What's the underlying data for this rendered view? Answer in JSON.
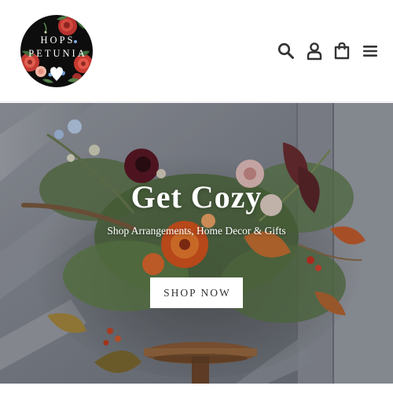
{
  "header": {
    "logo": {
      "line1": "HOPS",
      "line2": "PETUNIA",
      "background": "#0d0d0d"
    },
    "icons": [
      {
        "name": "search-icon"
      },
      {
        "name": "account-icon"
      },
      {
        "name": "cart-icon"
      },
      {
        "name": "menu-icon"
      }
    ],
    "icon_color": "#333333"
  },
  "hero": {
    "title": "Get Cozy",
    "subtitle": "Shop Arrangements, Home Decor & Gifts",
    "button_label": "SHOP NOW"
  }
}
